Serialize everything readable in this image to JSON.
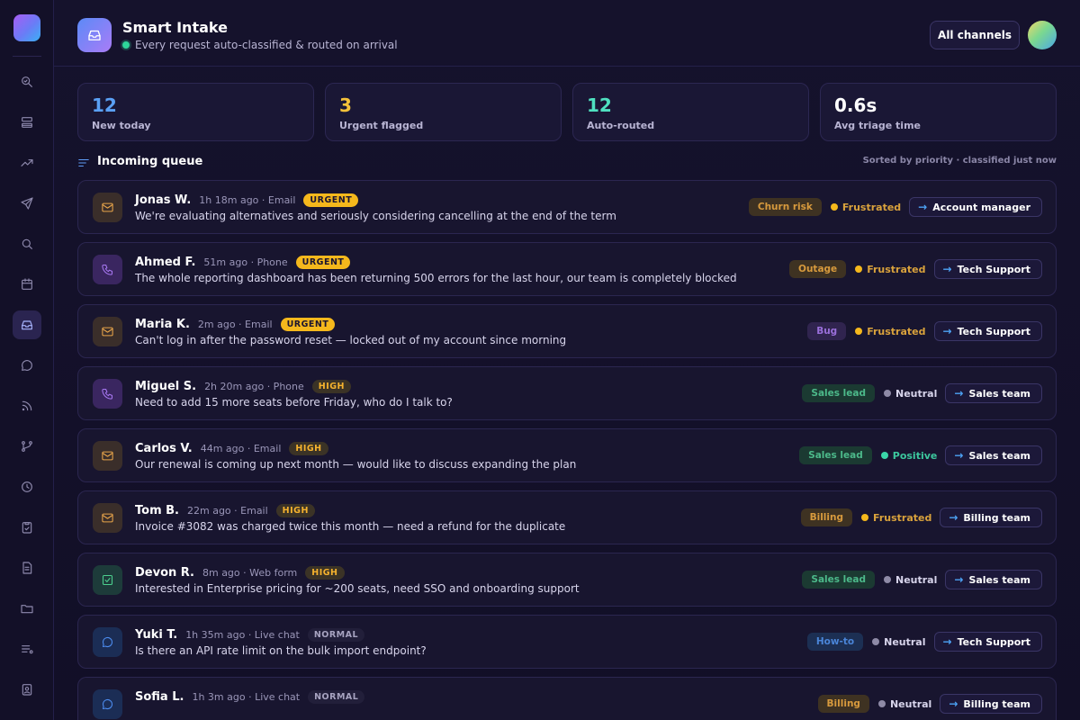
{
  "sidebar": {
    "icons": [
      "search-insights-icon",
      "inbox-stack-icon",
      "trending-icon",
      "send-icon",
      "search-icon",
      "calendar-icon",
      "inbox-icon",
      "chat-icon",
      "rss-icon",
      "branch-icon",
      "clock-icon",
      "clipboard-check-icon",
      "document-icon",
      "folder-icon",
      "list-icon",
      "badge-icon"
    ],
    "active": "inbox-icon"
  },
  "header": {
    "title": "Smart Intake",
    "subtitle": "Every request auto-classified & routed on arrival",
    "channel_filter": "All channels"
  },
  "stats": [
    {
      "value": "12",
      "label": "New today",
      "color": "#5aa0f5"
    },
    {
      "value": "3",
      "label": "Urgent flagged",
      "color": "#f5c23a"
    },
    {
      "value": "12",
      "label": "Auto-routed",
      "color": "#4fe0c0"
    },
    {
      "value": "0.6s",
      "label": "Avg triage time",
      "color": "#ffffff"
    }
  ],
  "queue": {
    "title": "Incoming queue",
    "sort_note": "Sorted by priority · classified just now"
  },
  "tickets": [
    {
      "name": "Jonas W.",
      "meta": "1h 18m ago · Email",
      "priority": "URGENT",
      "message": "We're evaluating alternatives and seriously considering cancelling at the end of the term",
      "tag": "Churn risk",
      "sentiment": "Frustrated",
      "route": "Account manager"
    },
    {
      "name": "Ahmed F.",
      "meta": "51m ago · Phone",
      "priority": "URGENT",
      "message": "The whole reporting dashboard has been returning 500 errors for the last hour, our team is completely blocked",
      "tag": "Outage",
      "sentiment": "Frustrated",
      "route": "Tech Support"
    },
    {
      "name": "Maria K.",
      "meta": "2m ago · Email",
      "priority": "URGENT",
      "message": "Can't log in after the password reset — locked out of my account since morning",
      "tag": "Bug",
      "sentiment": "Frustrated",
      "route": "Tech Support"
    },
    {
      "name": "Miguel S.",
      "meta": "2h 20m ago · Phone",
      "priority": "HIGH",
      "message": "Need to add 15 more seats before Friday, who do I talk to?",
      "tag": "Sales lead",
      "sentiment": "Neutral",
      "route": "Sales team"
    },
    {
      "name": "Carlos V.",
      "meta": "44m ago · Email",
      "priority": "HIGH",
      "message": "Our renewal is coming up next month — would like to discuss expanding the plan",
      "tag": "Sales lead",
      "sentiment": "Positive",
      "route": "Sales team"
    },
    {
      "name": "Tom B.",
      "meta": "22m ago · Email",
      "priority": "HIGH",
      "message": "Invoice #3082 was charged twice this month — need a refund for the duplicate",
      "tag": "Billing",
      "sentiment": "Frustrated",
      "route": "Billing team"
    },
    {
      "name": "Devon R.",
      "meta": "8m ago · Web form",
      "priority": "HIGH",
      "message": "Interested in Enterprise pricing for ~200 seats, need SSO and onboarding support",
      "tag": "Sales lead",
      "sentiment": "Neutral",
      "route": "Sales team"
    },
    {
      "name": "Yuki T.",
      "meta": "1h 35m ago · Live chat",
      "priority": "NORMAL",
      "message": "Is there an API rate limit on the bulk import endpoint?",
      "tag": "How-to",
      "sentiment": "Neutral",
      "route": "Tech Support"
    },
    {
      "name": "Sofia L.",
      "meta": "1h 3m ago · Live chat",
      "priority": "NORMAL",
      "message": "",
      "tag": "Billing",
      "sentiment": "Neutral",
      "route": "Billing team"
    }
  ]
}
